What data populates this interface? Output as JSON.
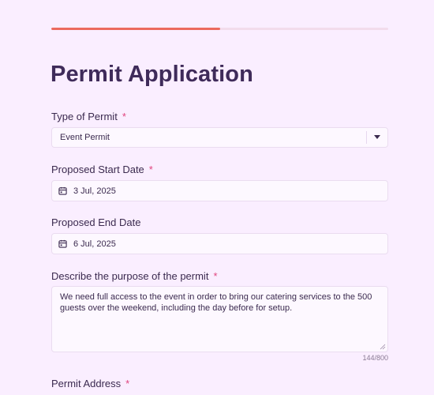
{
  "progress": {
    "fraction": 0.5
  },
  "form": {
    "title": "Permit Application",
    "required_marker": "*",
    "permit_type": {
      "label": "Type of Permit",
      "value": "Event Permit"
    },
    "start_date": {
      "label": "Proposed Start Date",
      "value": "3 Jul, 2025"
    },
    "end_date": {
      "label": "Proposed End Date",
      "value": "6 Jul, 2025"
    },
    "purpose": {
      "label": "Describe the purpose of the permit",
      "value": "We need full access to the event in order to bring our catering services to the 500 guests over the weekend, including the day before for setup.",
      "counter": "144/800"
    },
    "address": {
      "label": "Permit Address"
    }
  },
  "colors": {
    "background": "#faeeff",
    "accent": "#ec6a5e",
    "required": "#e0447e"
  },
  "icons": {
    "date": "calendar-icon",
    "select": "chevron-down-icon"
  }
}
